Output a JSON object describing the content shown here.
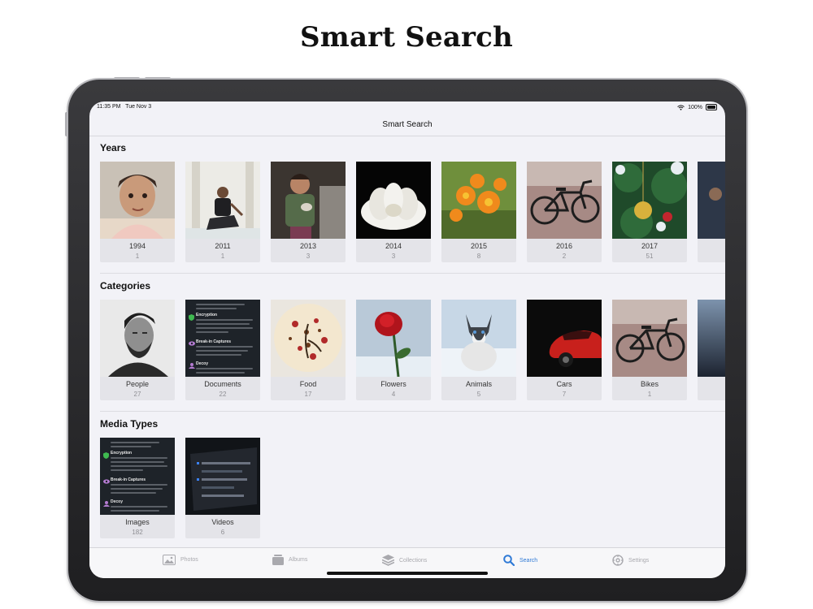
{
  "headline": "Smart Search",
  "status": {
    "time": "11:35 PM",
    "date": "Tue Nov 3",
    "battery": "100%"
  },
  "nav": {
    "title": "Smart Search"
  },
  "sections": [
    {
      "title": "Years",
      "items": [
        {
          "label": "1994",
          "count": "1"
        },
        {
          "label": "2011",
          "count": "1"
        },
        {
          "label": "2013",
          "count": "3"
        },
        {
          "label": "2014",
          "count": "3"
        },
        {
          "label": "2015",
          "count": "8"
        },
        {
          "label": "2016",
          "count": "2"
        },
        {
          "label": "2017",
          "count": "51"
        }
      ]
    },
    {
      "title": "Categories",
      "items": [
        {
          "label": "People",
          "count": "27"
        },
        {
          "label": "Documents",
          "count": "22"
        },
        {
          "label": "Food",
          "count": "17"
        },
        {
          "label": "Flowers",
          "count": "4"
        },
        {
          "label": "Animals",
          "count": "5"
        },
        {
          "label": "Cars",
          "count": "7"
        },
        {
          "label": "Bikes",
          "count": "1"
        }
      ]
    },
    {
      "title": "Media Types",
      "items": [
        {
          "label": "Images",
          "count": "182"
        },
        {
          "label": "Videos",
          "count": "6"
        }
      ]
    }
  ],
  "doc_text": {
    "encryption": "Encryption",
    "breakin": "Break-in Captures",
    "decoy": "Decoy"
  },
  "tabs": [
    {
      "label": "Photos",
      "icon": "photos-icon"
    },
    {
      "label": "Albums",
      "icon": "albums-icon"
    },
    {
      "label": "Collections",
      "icon": "collections-icon"
    },
    {
      "label": "Search",
      "icon": "search-icon"
    },
    {
      "label": "Settings",
      "icon": "settings-icon"
    }
  ],
  "colors": {
    "accent": "#2f7ad6",
    "background": "#f2f2f7",
    "card": "#e4e4e9"
  }
}
